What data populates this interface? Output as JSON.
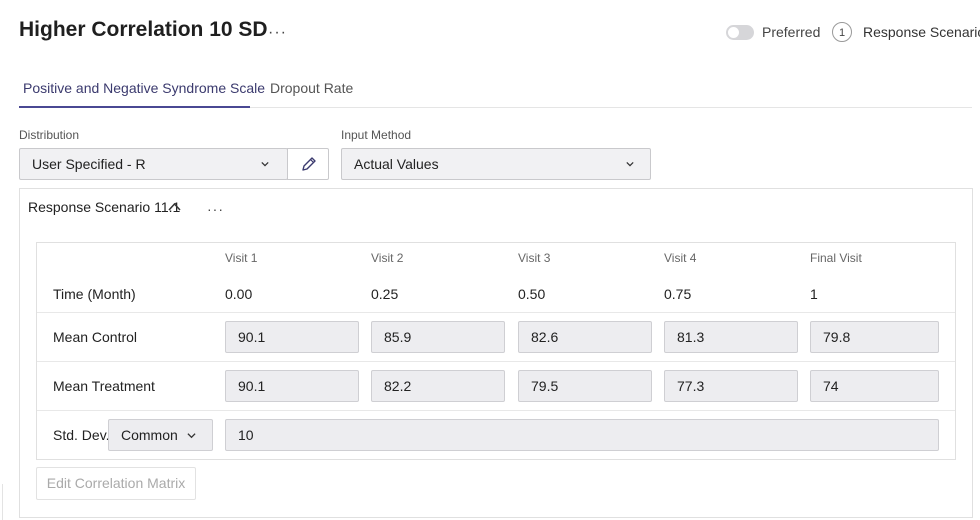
{
  "header": {
    "title": "Higher Correlation 10 SD",
    "more_menu": "···",
    "preferred_label": "Preferred",
    "preferred_on": false,
    "scenario_count": "1",
    "response_label": "Response Scenario"
  },
  "tabs": [
    {
      "label": "Positive and Negative Syndrome Scale",
      "active": true
    },
    {
      "label": "Dropout Rate",
      "active": false
    }
  ],
  "distribution": {
    "label": "Distribution",
    "value": "User Specified - R"
  },
  "input_method": {
    "label": "Input Method",
    "value": "Actual Values"
  },
  "scenario": {
    "title": "Response Scenario 11.1",
    "more_menu": "···",
    "columns": [
      "Visit 1",
      "Visit 2",
      "Visit 3",
      "Visit 4",
      "Final Visit"
    ],
    "time_row": {
      "label": "Time (Month)",
      "values": [
        "0.00",
        "0.25",
        "0.50",
        "0.75",
        "1"
      ]
    },
    "mean_control": {
      "label": "Mean Control",
      "values": [
        "90.1",
        "85.9",
        "82.6",
        "81.3",
        "79.8"
      ]
    },
    "mean_treatment": {
      "label": "Mean Treatment",
      "values": [
        "90.1",
        "82.2",
        "79.5",
        "77.3",
        "74"
      ]
    },
    "std_dev": {
      "label": "Std. Dev.",
      "mode": "Common",
      "value": "10"
    },
    "edit_correlation_label": "Edit Correlation Matrix"
  },
  "colors": {
    "accent": "#4a4893",
    "input_bg": "#ededf0",
    "border": "#e0e0e0"
  }
}
